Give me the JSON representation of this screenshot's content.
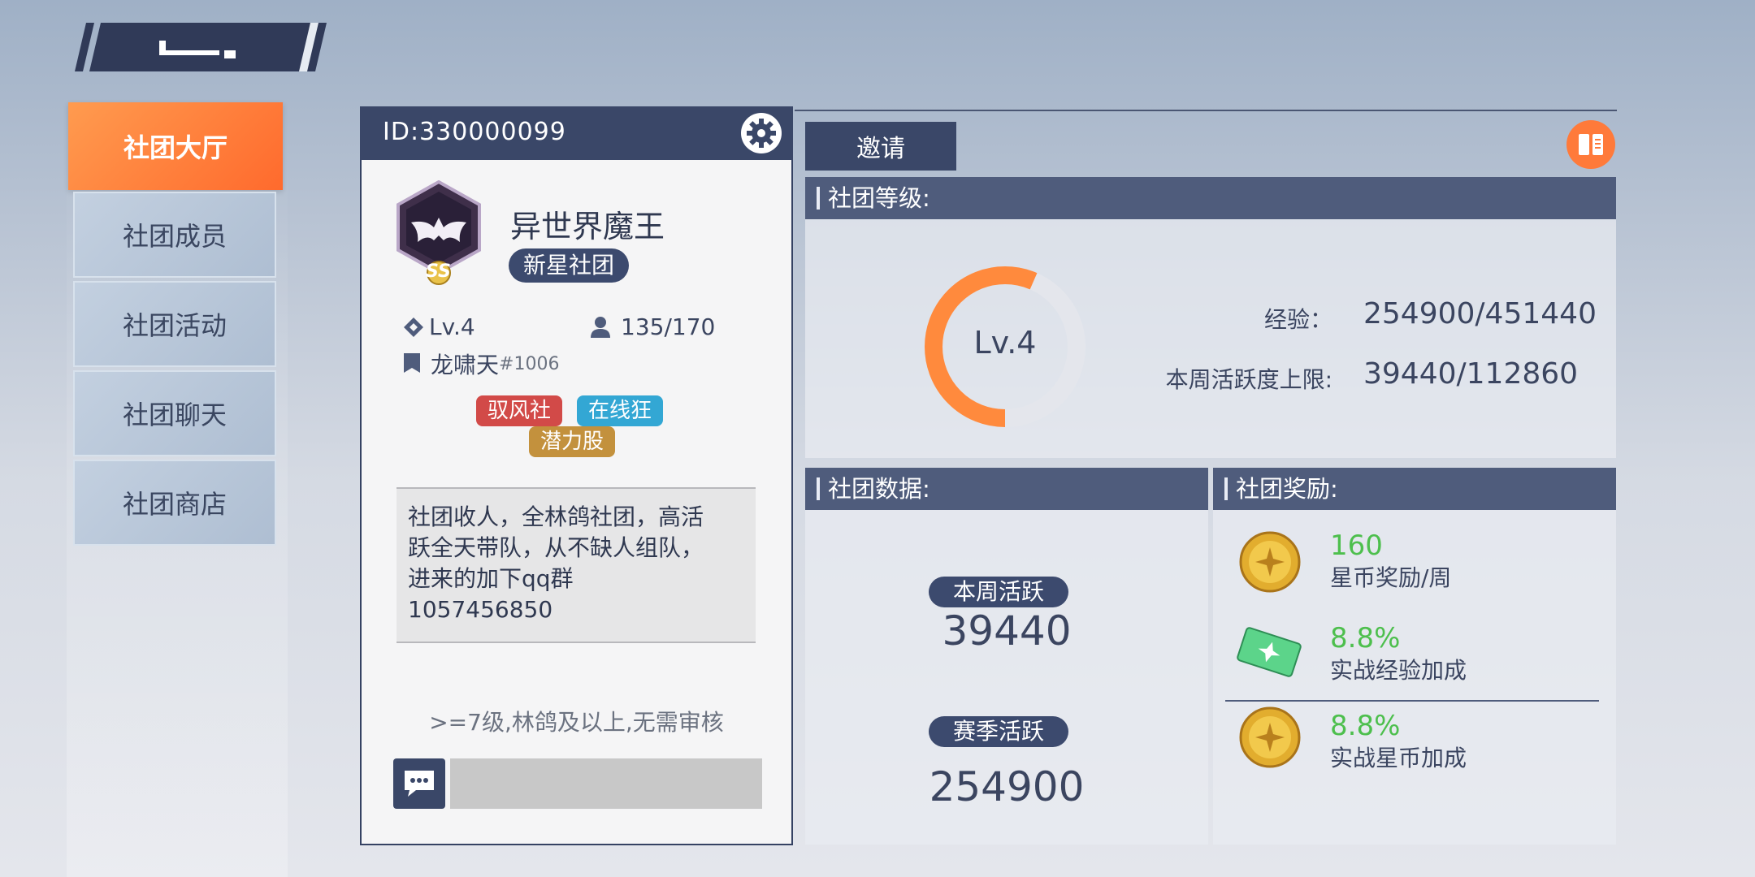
{
  "sidebar": {
    "items": [
      {
        "label": "社团大厅",
        "active": true
      },
      {
        "label": "社团成员"
      },
      {
        "label": "社团活动"
      },
      {
        "label": "社团聊天"
      },
      {
        "label": "社团商店"
      }
    ]
  },
  "club": {
    "id": "ID:330000099",
    "name": "异世界魔王",
    "rank_badge": "新星社团",
    "emblem_grade": "SS",
    "level": "Lv.4",
    "members": "135/170",
    "leader": "龙啸天",
    "leader_tag": "#1006",
    "tags": [
      {
        "label": "驭风社",
        "color": "#d24a48"
      },
      {
        "label": "在线狂",
        "color": "#33a7d4"
      },
      {
        "label": "潜力股",
        "color": "#c3913d"
      }
    ],
    "description": "社团收人，全林鸽社团，高活\n跃全天带队，从不缺人组队，\n进来的加下qq群\n1057456850",
    "join_requirement": ">=7级,林鸽及以上,无需审核"
  },
  "actions": {
    "invite_label": "邀请"
  },
  "level_panel": {
    "title": "社团等级:",
    "level": "Lv.4",
    "exp_label": "经验：",
    "exp_value": "254900/451440",
    "exp_progress": 0.565,
    "weekly_cap_label": "本周活跃度上限:",
    "weekly_cap_value": "39440/112860"
  },
  "data_panel": {
    "title": "社团数据:",
    "weekly_label": "本周活跃",
    "weekly_value": "39440",
    "season_label": "赛季活跃",
    "season_value": "254900"
  },
  "reward_panel": {
    "title": "社团奖励:",
    "rewards": [
      {
        "value": "160",
        "label": "星币奖励/周",
        "icon": "gold-coin-icon"
      },
      {
        "value": "8.8%",
        "label": "实战经验加成",
        "icon": "exp-ticket-icon"
      },
      {
        "value": "8.8%",
        "label": "实战星币加成",
        "icon": "gold-coin-icon"
      }
    ]
  },
  "colors": {
    "accent": "#ff7a3a",
    "navy": "#3a4768",
    "reward_green": "#4dbf4d"
  }
}
